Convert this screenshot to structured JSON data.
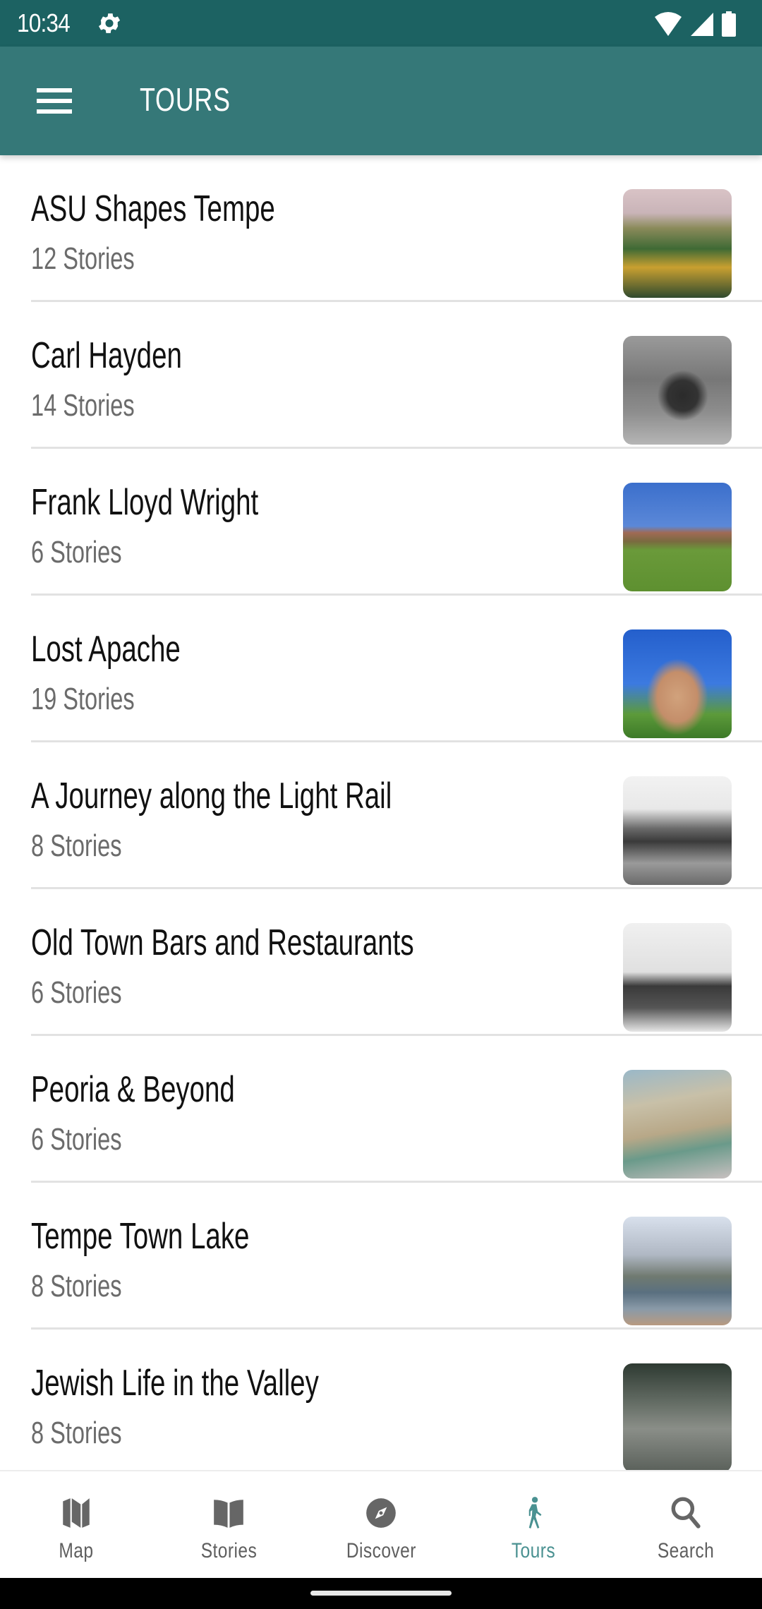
{
  "status_bar": {
    "time": "10:34",
    "icons": [
      "gear-icon",
      "wifi-icon",
      "signal-icon",
      "battery-icon"
    ]
  },
  "app_bar": {
    "menu_icon": "hamburger-menu-icon",
    "title": "TOURS",
    "color": "#357878"
  },
  "tours": [
    {
      "title": "ASU Shapes Tempe",
      "count": "12 Stories"
    },
    {
      "title": "Carl Hayden",
      "count": "14 Stories"
    },
    {
      "title": "Frank Lloyd Wright",
      "count": "6 Stories"
    },
    {
      "title": "Lost Apache",
      "count": "19 Stories"
    },
    {
      "title": "A Journey along the Light Rail",
      "count": "8 Stories"
    },
    {
      "title": "Old Town Bars and Restaurants",
      "count": "6 Stories"
    },
    {
      "title": "Peoria & Beyond",
      "count": "6 Stories"
    },
    {
      "title": "Tempe Town Lake",
      "count": "8 Stories"
    },
    {
      "title": "Jewish Life in the Valley",
      "count": "8 Stories"
    }
  ],
  "bottom_nav": {
    "active": "Tours",
    "active_color": "#4a9191",
    "items": [
      {
        "label": "Map",
        "icon": "map-icon"
      },
      {
        "label": "Stories",
        "icon": "book-icon"
      },
      {
        "label": "Discover",
        "icon": "compass-icon"
      },
      {
        "label": "Tours",
        "icon": "walking-person-icon"
      },
      {
        "label": "Search",
        "icon": "search-icon"
      }
    ]
  }
}
